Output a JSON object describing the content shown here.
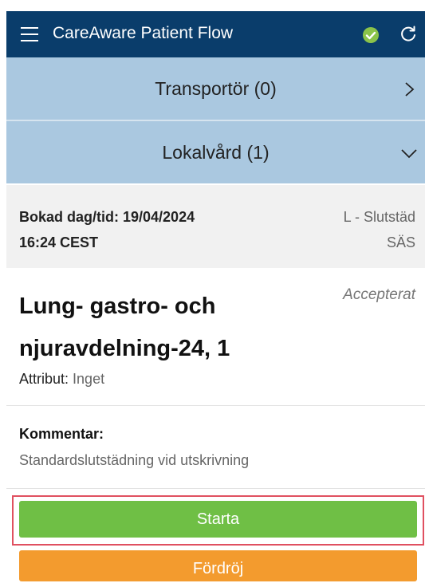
{
  "header": {
    "title": "CareAware Patient Flow",
    "status_color": "#8bc34a",
    "icons": [
      "menu-icon",
      "status-check-icon",
      "refresh-icon"
    ]
  },
  "sections": [
    {
      "label": "Transportör (0)",
      "state": "collapsed"
    },
    {
      "label": "Lokalvård (1)",
      "state": "expanded"
    }
  ],
  "task": {
    "booked_line1": "Bokad dag/tid: 19/04/2024",
    "booked_line2": "16:24 CEST",
    "type_line1": "L - Slutstäd",
    "type_line2": "SÄS",
    "title_line1": "Lung- gastro- och",
    "title_line2": "njuravdelning-24, 1",
    "status": "Accepterat",
    "attribute_label": "Attribut:",
    "attribute_value": "Inget",
    "comment_label": "Kommentar:",
    "comment_text": "Standardslutstädning vid utskrivning"
  },
  "actions": {
    "start_label": "Starta",
    "delay_label": "Fördröj",
    "start_color": "#6fbf45",
    "delay_color": "#f39b2e"
  }
}
